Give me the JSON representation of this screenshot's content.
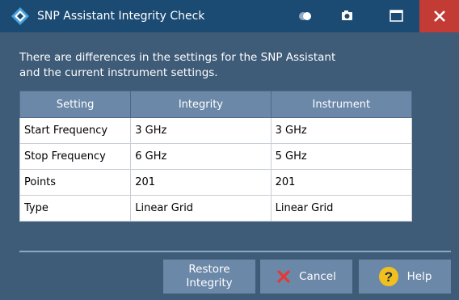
{
  "window": {
    "title": "SNP Assistant Integrity Check",
    "icons": [
      "rs-logo-icon",
      "toggle-icon",
      "camera-icon",
      "maximize-icon",
      "close-icon"
    ]
  },
  "message": {
    "line1": "There are differences in the settings for the SNP Assistant",
    "line2": "and the current instrument settings."
  },
  "table": {
    "headers": [
      "Setting",
      "Integrity",
      "Instrument"
    ],
    "rows": [
      [
        "Start Frequency",
        "3 GHz",
        "3 GHz"
      ],
      [
        "Stop Frequency",
        "6 GHz",
        "5 GHz"
      ],
      [
        "Points",
        "201",
        "201"
      ],
      [
        "Type",
        "Linear Grid",
        "Linear Grid"
      ]
    ]
  },
  "buttons": {
    "restore_line1": "Restore",
    "restore_line2": "Integrity",
    "cancel": "Cancel",
    "help": "Help"
  },
  "colors": {
    "titlebar": "#1b4a73",
    "background": "#3e5b78",
    "button": "#6b88a8",
    "close": "#c23b34",
    "cancel_x": "#e53935",
    "help_circle": "#f2c01e"
  }
}
